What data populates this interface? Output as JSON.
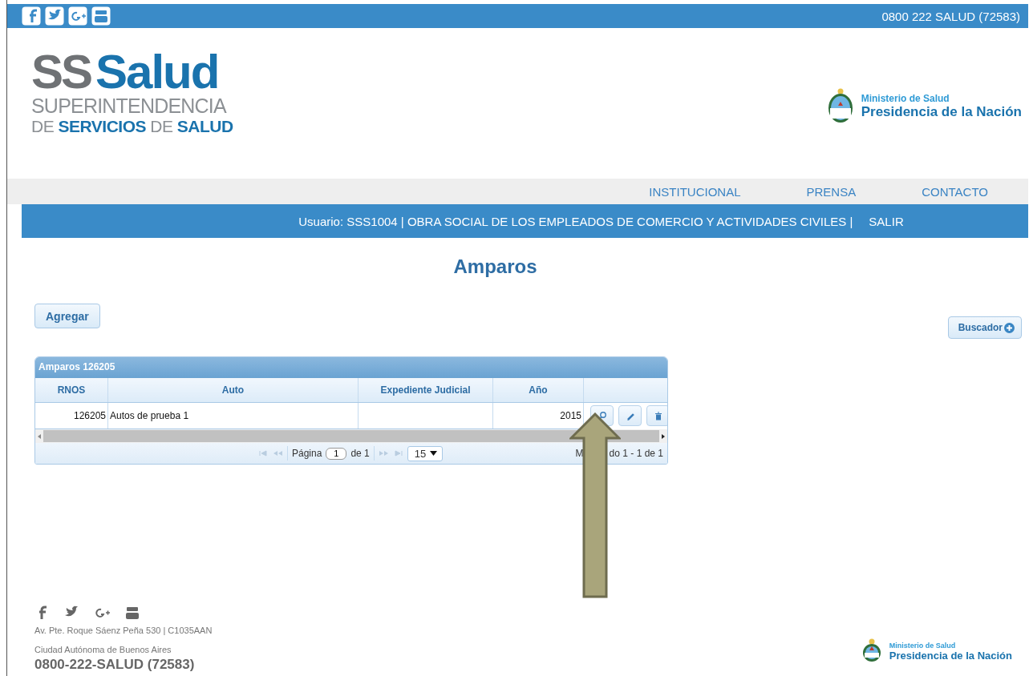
{
  "top_bar": {
    "phone": "0800 222 SALUD (72583)"
  },
  "logo": {
    "mark": "SS",
    "name": "Salud",
    "line_1": "SUPERINTENDENCIA",
    "line_2": "DE **SERVICIOS** DE **SALUD**"
  },
  "ministry": {
    "line_1": "Ministerio de Salud",
    "line_2": "Presidencia de la Nación"
  },
  "nav": [
    "INSTITUCIONAL",
    "PRENSA",
    "CONTACTO"
  ],
  "user_bar": {
    "text": "Usuario: SSS1004 | OBRA SOCIAL DE LOS EMPLEADOS DE COMERCIO Y ACTIVIDADES CIVILES |",
    "logout": "SALIR"
  },
  "page_title": "Amparos",
  "add_button": "Agregar",
  "search_button": "Buscador",
  "grid": {
    "caption": "Amparos 126205",
    "columns": [
      "RNOS",
      "Auto",
      "Expediente Judicial",
      "Año"
    ],
    "rows": [
      {
        "rnos": "126205",
        "auto": "Autos de prueba 1",
        "year": "2015"
      }
    ],
    "pager": {
      "label": "Página",
      "page": "1",
      "of": "de 1",
      "page_size": "15",
      "info_parts": [
        "M",
        "do 1 - 1 de 1"
      ]
    }
  },
  "footer": {
    "address": "Av. Pte. Roque Sáenz Peña 530 | C1035AAN",
    "city": "Ciudad Autónoma de Buenos Aires",
    "phone": "0800-222-SALUD (72583)",
    "ministry_line_1": "Ministerio de Salud",
    "ministry_line_2": "Presidencia de la Nación"
  }
}
